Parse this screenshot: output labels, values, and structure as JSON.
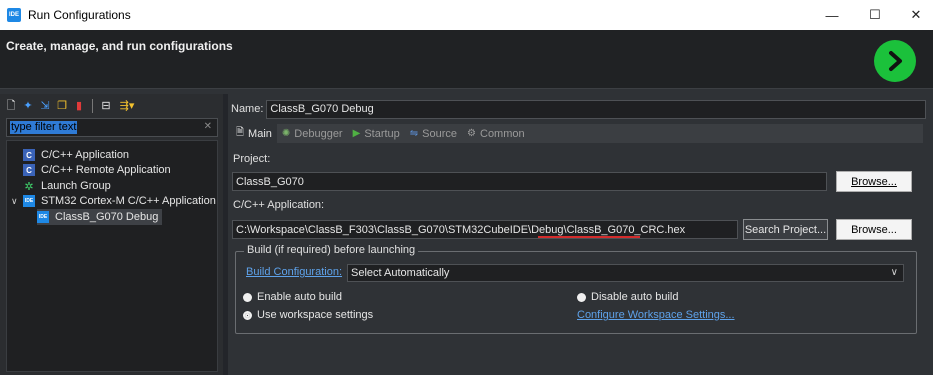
{
  "window": {
    "title": "Run Configurations",
    "app_icon_text": "IDE",
    "minimize_glyph": "—",
    "maximize_glyph": "☐",
    "close_glyph": "✕"
  },
  "header": {
    "heading": "Create, manage, and run configurations",
    "run_icon": "run-arrow-icon",
    "run_color": "#1bc13b"
  },
  "left": {
    "filter_placeholder": "type filter text",
    "toolbar_icons": [
      "new-config-icon",
      "new-prototype-icon",
      "export-icon",
      "duplicate-icon",
      "delete-icon",
      "collapse-all-icon",
      "filter-icon"
    ],
    "tree": [
      {
        "label": "C/C++ Application",
        "icon": "cc-icon",
        "badge": "C"
      },
      {
        "label": "C/C++ Remote Application",
        "icon": "cc-icon",
        "badge": "C"
      },
      {
        "label": "Launch Group",
        "icon": "launch-group-icon"
      },
      {
        "label": "STM32 Cortex-M C/C++ Application",
        "icon": "ide-icon",
        "badge": "IDE",
        "expanded": true
      },
      {
        "label": "ClassB_G070 Debug",
        "icon": "ide-icon",
        "badge": "IDE",
        "selected": true
      }
    ]
  },
  "right": {
    "name_label": "Name:",
    "name_value": "ClassB_G070 Debug",
    "tabs": [
      {
        "label": "Main",
        "icon": "main-tab-icon",
        "active": true
      },
      {
        "label": "Debugger",
        "icon": "debugger-tab-icon"
      },
      {
        "label": "Startup",
        "icon": "startup-tab-icon"
      },
      {
        "label": "Source",
        "icon": "source-tab-icon"
      },
      {
        "label": "Common",
        "icon": "common-tab-icon"
      }
    ],
    "project_label": "Project:",
    "project_value": "ClassB_G070",
    "browse_label": "Browse...",
    "app_label": "C/C++ Application:",
    "app_path_prefix": "C:\\Workspace\\ClassB_F303\\ClassB_G070\\STM32CubeIDE\\Debug\\",
    "app_path_file": "ClassB_G070_CRC.hex",
    "highlight_color": "#d42c2c",
    "search_project_label": "Search Project...",
    "browse2_label": "Browse...",
    "build_group_title": "Build (if required) before launching",
    "build_config_link": "Build Configuration:",
    "build_config_value": "Select Automatically",
    "enable_auto_build": "Enable auto build",
    "disable_auto_build": "Disable auto build",
    "use_workspace_settings": "Use workspace settings",
    "configure_link": "Configure Workspace Settings..."
  }
}
